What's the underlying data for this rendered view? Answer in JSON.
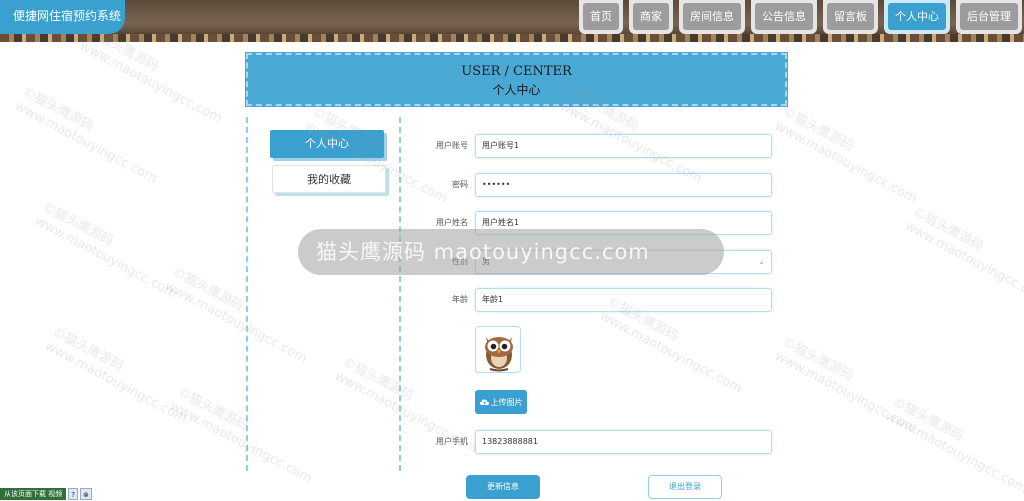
{
  "brand": "便捷网住宿预约系统",
  "nav": [
    {
      "label": "首页",
      "active": false
    },
    {
      "label": "商家",
      "active": false
    },
    {
      "label": "房间信息",
      "active": false
    },
    {
      "label": "公告信息",
      "active": false
    },
    {
      "label": "留言板",
      "active": false
    },
    {
      "label": "个人中心",
      "active": true
    },
    {
      "label": "后台管理",
      "active": false
    }
  ],
  "title": {
    "en": "USER / CENTER",
    "cn": "个人中心"
  },
  "sidebar": {
    "items": [
      {
        "label": "个人中心",
        "active": true
      },
      {
        "label": "我的收藏",
        "active": false
      }
    ]
  },
  "form": {
    "account_label": "用户账号",
    "account_value": "用户账号1",
    "password_label": "密码",
    "password_value": "••••••",
    "name_label": "用户姓名",
    "name_value": "用户姓名1",
    "gender_label": "性别",
    "gender_value": "男",
    "age_label": "年龄",
    "age_value": "年龄1",
    "upload_label": "上传图片",
    "phone_label": "用户手机",
    "phone_value": "13823888881",
    "save_label": "更新信息",
    "logout_label": "退出登录"
  },
  "watermark": {
    "banner": "猫头鹰源码 maotouyingcc.com",
    "text_cn": "©猫头鹰源码",
    "text_url": "www.maotouyingcc.com"
  },
  "download_bar": {
    "label": "从该页面下载 视频",
    "help": "?",
    "close": "⊗"
  },
  "colors": {
    "accent": "#3aa0cf",
    "accent_light": "#8fcde8",
    "nav_inactive": "#9c9c9c"
  }
}
